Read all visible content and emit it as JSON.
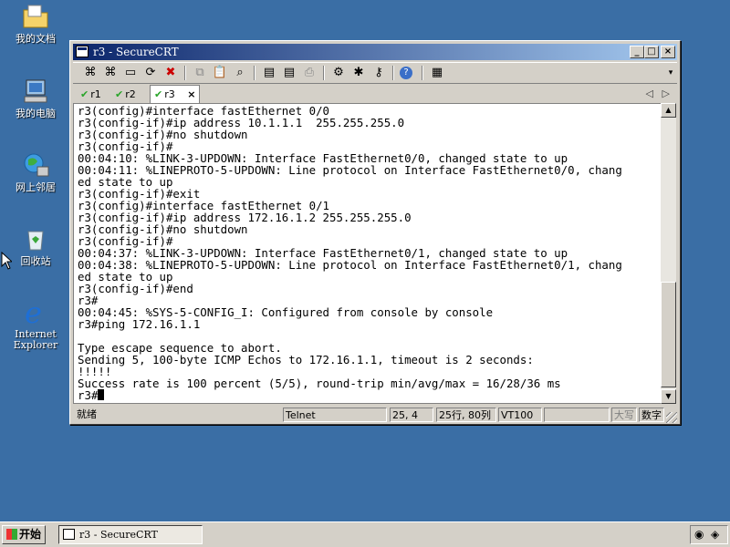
{
  "desktop": {
    "icons": [
      {
        "label": "我的文档"
      },
      {
        "label": "我的电脑"
      },
      {
        "label": "网上邻居"
      },
      {
        "label": "回收站"
      },
      {
        "label": "Internet\nExplorer"
      }
    ]
  },
  "window": {
    "title": "r3 - SecureCRT",
    "controls": {
      "minimize": "_",
      "maximize": "□",
      "close": "×"
    }
  },
  "tabs": [
    {
      "label": "r1",
      "status": "connected"
    },
    {
      "label": "r2",
      "status": "connected"
    },
    {
      "label": "r3",
      "status": "connected",
      "active": true
    }
  ],
  "tab_close": "×",
  "terminal": {
    "lines": [
      "r3(config)#interface fastEthernet 0/0",
      "r3(config-if)#ip address 10.1.1.1  255.255.255.0",
      "r3(config-if)#no shutdown",
      "r3(config-if)#",
      "00:04:10: %LINK-3-UPDOWN: Interface FastEthernet0/0, changed state to up",
      "00:04:11: %LINEPROTO-5-UPDOWN: Line protocol on Interface FastEthernet0/0, chang",
      "ed state to up",
      "r3(config-if)#exit",
      "r3(config)#interface fastEthernet 0/1",
      "r3(config-if)#ip address 172.16.1.2 255.255.255.0",
      "r3(config-if)#no shutdown",
      "r3(config-if)#",
      "00:04:37: %LINK-3-UPDOWN: Interface FastEthernet0/1, changed state to up",
      "00:04:38: %LINEPROTO-5-UPDOWN: Line protocol on Interface FastEthernet0/1, chang",
      "ed state to up",
      "r3(config-if)#end",
      "r3#",
      "00:04:45: %SYS-5-CONFIG_I: Configured from console by console",
      "r3#ping 172.16.1.1",
      "",
      "Type escape sequence to abort.",
      "Sending 5, 100-byte ICMP Echos to 172.16.1.1, timeout is 2 seconds:",
      "!!!!!",
      "Success rate is 100 percent (5/5), round-trip min/avg/max = 16/28/36 ms"
    ],
    "prompt": "r3#"
  },
  "status": {
    "ready": "就绪",
    "protocol": "Telnet",
    "position": "25,  4",
    "size": "25行, 80列",
    "emulation": "VT100",
    "caps": "大写",
    "num": "数字"
  },
  "taskbar": {
    "start": "开始",
    "task": "r3 - SecureCRT"
  }
}
